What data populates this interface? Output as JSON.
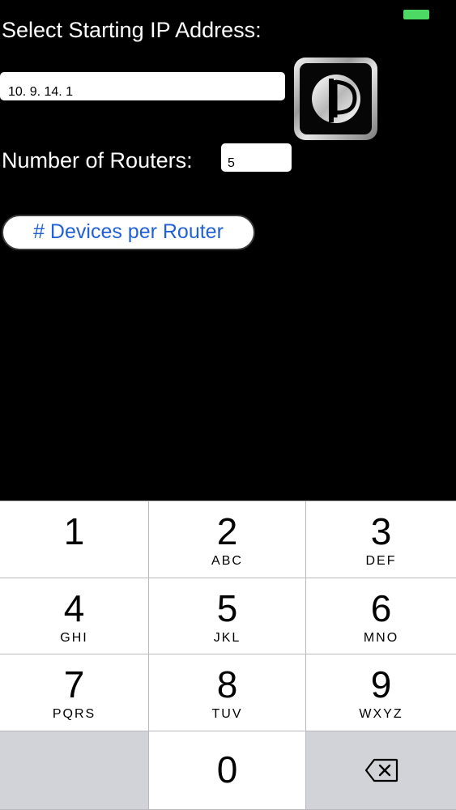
{
  "status_bar": {
    "battery_color": "#4cd964",
    "battery_icon": "battery-icon"
  },
  "form": {
    "ip_label": "Select Starting IP Address:",
    "ip_value": "10. 9. 14. 1",
    "routers_label": "Number of Routers:",
    "routers_value": "5",
    "devices_button_label": "# Devices per Router",
    "logo_icon": "app-logo-icon"
  },
  "colors": {
    "background": "#000000",
    "label_text": "#ffffff",
    "button_text": "#2060d8",
    "keypad_key": "#ffffff",
    "keypad_gray": "#d2d3d8"
  },
  "keypad": {
    "keys": [
      {
        "digit": "1",
        "letters": ""
      },
      {
        "digit": "2",
        "letters": "ABC"
      },
      {
        "digit": "3",
        "letters": "DEF"
      },
      {
        "digit": "4",
        "letters": "GHI"
      },
      {
        "digit": "5",
        "letters": "JKL"
      },
      {
        "digit": "6",
        "letters": "MNO"
      },
      {
        "digit": "7",
        "letters": "PQRS"
      },
      {
        "digit": "8",
        "letters": "TUV"
      },
      {
        "digit": "9",
        "letters": "WXYZ"
      }
    ],
    "zero": "0",
    "delete_icon": "delete-backspace-icon"
  }
}
